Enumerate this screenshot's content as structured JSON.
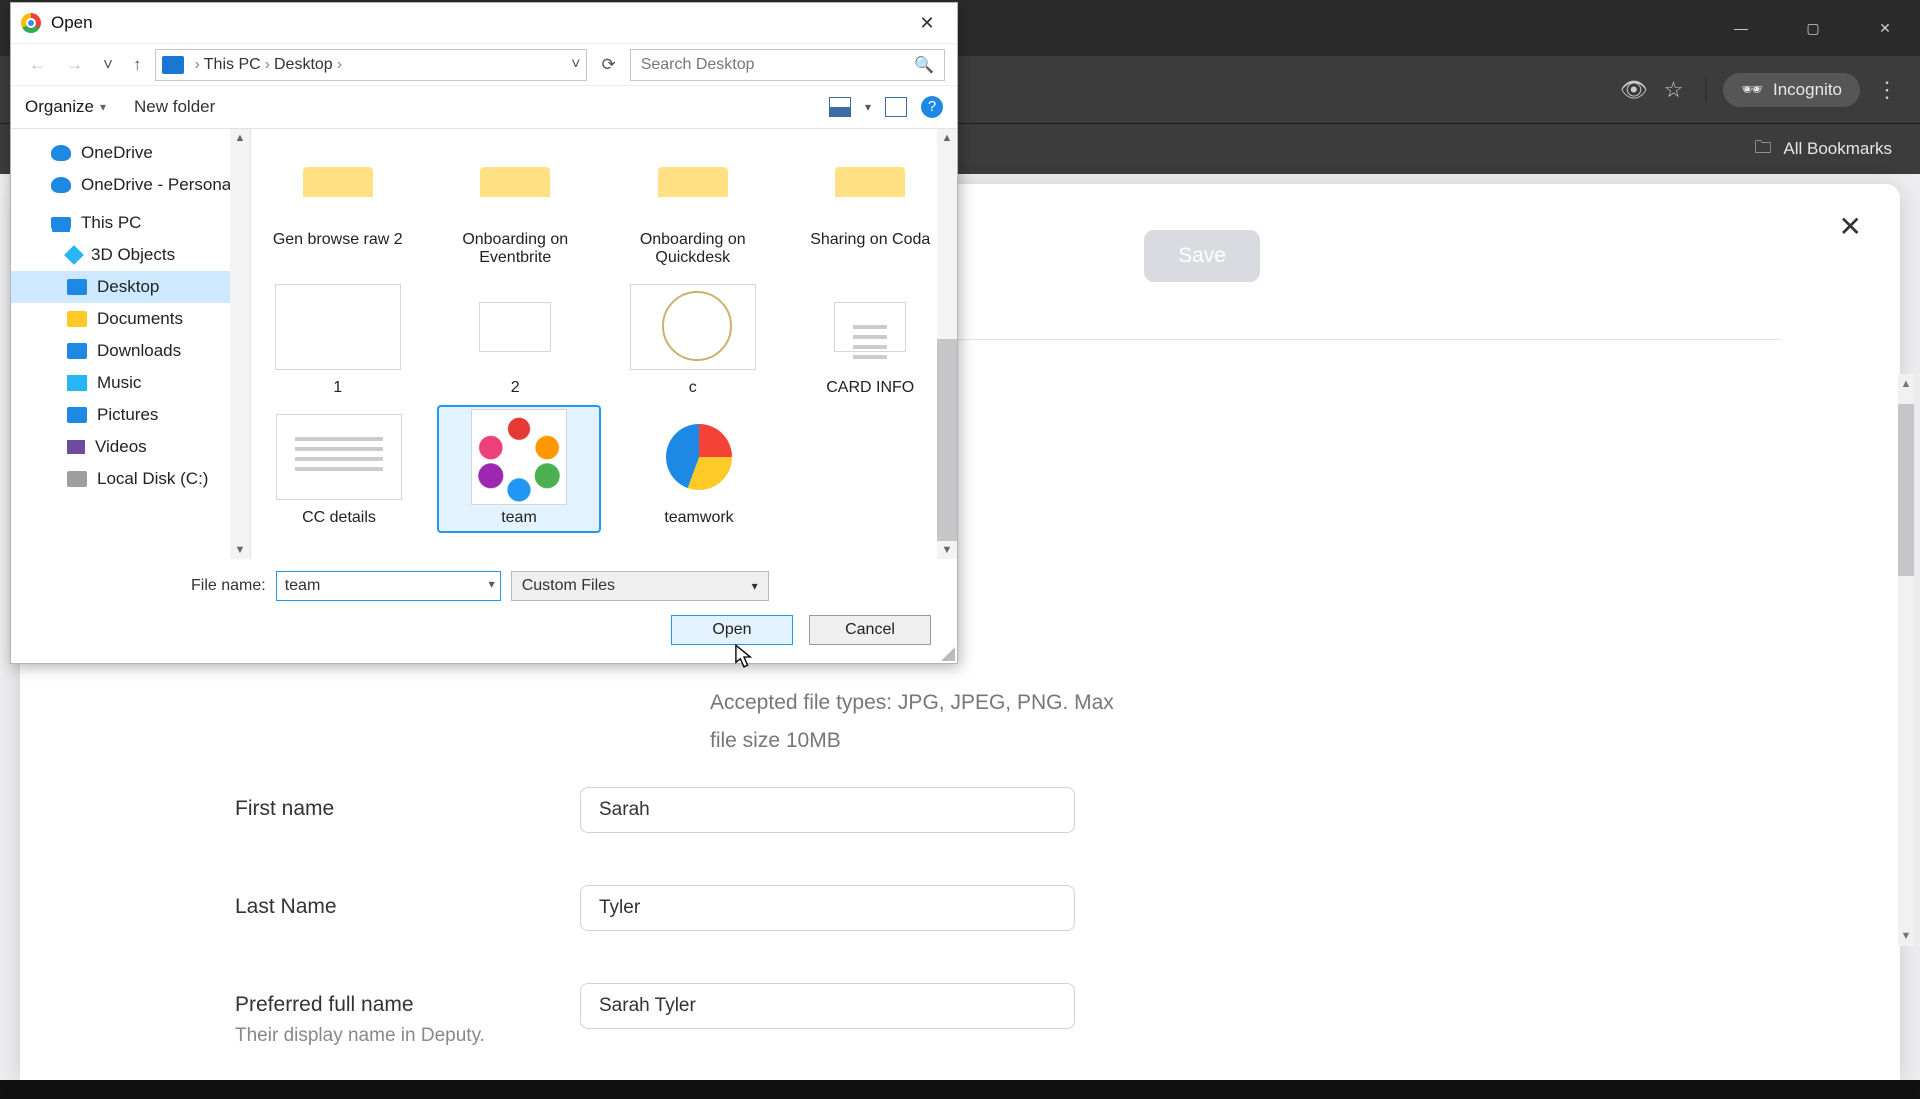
{
  "browser": {
    "incognito_label": "Incognito",
    "bookmarks_label": "All Bookmarks"
  },
  "modal": {
    "save": "Save",
    "hint_line1": "Accepted file types: JPG, JPEG, PNG. Max",
    "hint_line2": "file size 10MB",
    "form": {
      "first_name_label": "First name",
      "first_name_value": "Sarah",
      "last_name_label": "Last Name",
      "last_name_value": "Tyler",
      "pref_label": "Preferred full name",
      "pref_value": "Sarah Tyler",
      "pref_sub": "Their display name in Deputy."
    }
  },
  "dialog": {
    "title": "Open",
    "breadcrumb": {
      "l1": "This PC",
      "l2": "Desktop"
    },
    "search_placeholder": "Search Desktop",
    "toolbar": {
      "organize": "Organize",
      "newfolder": "New folder"
    },
    "tree": {
      "onedrive": "OneDrive",
      "onedrive_personal": "OneDrive - Personal",
      "this_pc": "This PC",
      "objects3d": "3D Objects",
      "desktop": "Desktop",
      "documents": "Documents",
      "downloads": "Downloads",
      "music": "Music",
      "pictures": "Pictures",
      "videos": "Videos",
      "localdisk": "Local Disk (C:)"
    },
    "files": {
      "f1": "Gen browse raw 2",
      "f2": "Onboarding on Eventbrite",
      "f3": "Onboarding on Quickdesk",
      "f4": "Sharing on Coda",
      "f5": "1",
      "f6": "2",
      "f7": "c",
      "f8": "CARD INFO",
      "f9": "CC details",
      "f10": "team",
      "f11": "teamwork"
    },
    "filename_label": "File name:",
    "filename_value": "team",
    "filetype": "Custom Files",
    "open": "Open",
    "cancel": "Cancel"
  }
}
